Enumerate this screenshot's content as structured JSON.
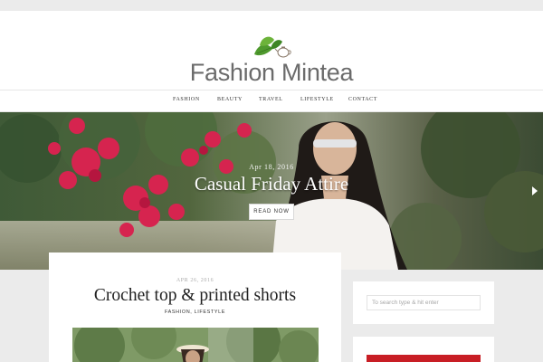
{
  "site": {
    "title": "Fashion Mintea"
  },
  "nav": {
    "items": [
      "FASHION",
      "BEAUTY",
      "TRAVEL",
      "LIFESTYLE",
      "CONTACT"
    ]
  },
  "hero": {
    "date": "Apr 18, 2016",
    "title": "Casual Friday Attire",
    "button_label": "READ NOW"
  },
  "post": {
    "date": "APR 26, 2016",
    "title": "Crochet top & printed shorts",
    "categories": "FASHION, LIFESTYLE"
  },
  "sidebar": {
    "search": {
      "placeholder": "To search type & hit enter"
    }
  },
  "colors": {
    "accent_red": "#c81e25",
    "logo_green": "#4f9a2e",
    "background": "#ebebeb"
  }
}
